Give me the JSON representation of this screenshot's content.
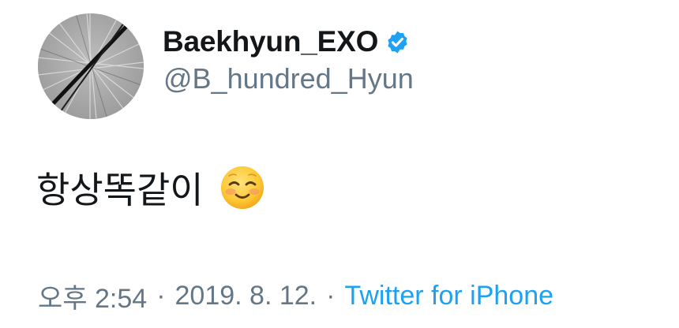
{
  "tweet": {
    "author": {
      "display_name": "Baekhyun_EXO",
      "handle": "@B_hundred_Hyun",
      "verified": true
    },
    "text": "항상똑같이",
    "emoji": "smiling-face-with-smiling-eyes",
    "meta": {
      "time": "오후 2:54",
      "separator": "·",
      "date": "2019. 8. 12.",
      "source": "Twitter for iPhone"
    }
  },
  "colors": {
    "text_primary": "#14171a",
    "text_secondary": "#657786",
    "accent": "#1da1f2",
    "verified": "#1da1f2"
  },
  "icons": {
    "verified": "verified-badge-icon",
    "avatar": "avatar-image"
  }
}
